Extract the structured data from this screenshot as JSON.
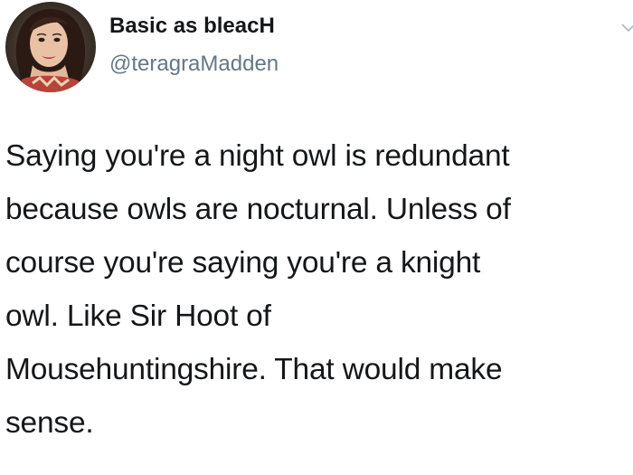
{
  "tweet": {
    "author": {
      "display_name": "Basic as bleacH",
      "handle": "@teragraMadden",
      "avatar_icon": "profile-photo-avatar"
    },
    "menu_icon": "chevron-down-icon",
    "text_lines": [
      "Saying you're a night owl is redundant",
      "because owls are nocturnal. Unless of",
      "course you're saying you're a knight",
      "owl. Like Sir Hoot of",
      "Mousehuntingshire. That would make",
      "sense."
    ]
  },
  "colors": {
    "text": "#14171a",
    "secondary_text": "#657786",
    "background": "#ffffff"
  }
}
